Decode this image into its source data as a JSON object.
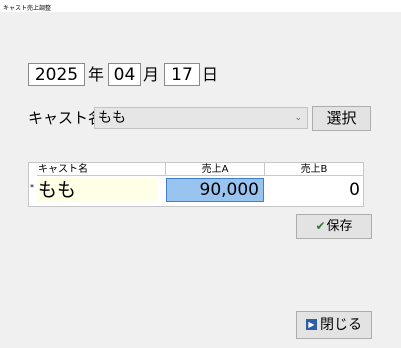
{
  "window": {
    "title": "キャスト売上調整"
  },
  "date": {
    "year": "2025",
    "year_label": "年",
    "month": "04",
    "month_label": "月",
    "day": "17",
    "day_label": "日"
  },
  "cast": {
    "label": "キャスト名",
    "selected": "もも",
    "select_button": "選択"
  },
  "grid": {
    "headers": [
      "キャスト名",
      "売上A",
      "売上B"
    ],
    "row_marker": "*",
    "row": {
      "name": "もも",
      "sales_a": "90,000",
      "sales_b": "0"
    }
  },
  "buttons": {
    "save": "保存",
    "close": "閉じる"
  },
  "icons": {
    "save": "check-icon",
    "close": "exit-icon"
  },
  "colors": {
    "selected_cell": "#99c4ef",
    "name_cell": "#ffffe6"
  }
}
